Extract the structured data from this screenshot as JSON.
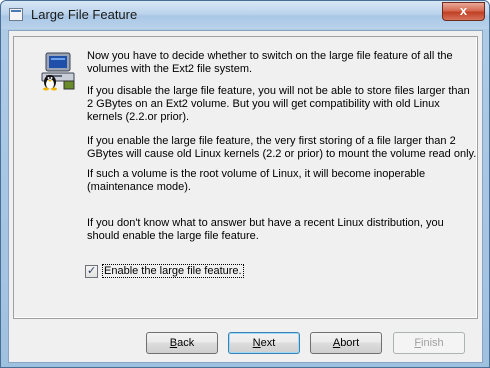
{
  "window": {
    "title": "Large File Feature",
    "close_glyph": "x"
  },
  "content": {
    "para1": "Now you have to decide whether to switch on the large file feature of all the volumes with the Ext2 file system.",
    "para2": "If you disable the large file feature, you will not be able to store files larger than 2 GBytes on an Ext2 volume. But you will get compatibility with old Linux kernels (2.2.or prior).",
    "para3": "If you enable the large file feature, the very first storing of a file larger than 2 GBytes will cause old Linux kernels (2.2 or prior) to mount the volume read only.",
    "para4": "If such a volume is the root volume of Linux, it will become inoperable (maintenance mode).",
    "para5": "If you don't know what to answer but have a recent Linux distribution, you should enable the large file feature."
  },
  "checkbox": {
    "label": "Enable the large file feature.",
    "checked": true
  },
  "buttons": {
    "back": {
      "access_key": "B",
      "rest": "ack"
    },
    "next": {
      "access_key": "N",
      "rest": "ext"
    },
    "abort": {
      "access_key": "A",
      "rest": "bort"
    },
    "finish": {
      "access_key": "F",
      "rest": "inish",
      "enabled": false
    }
  },
  "icons": {
    "app": "linux-tux-computer-icon",
    "window": "window-icon",
    "close": "close-icon"
  }
}
